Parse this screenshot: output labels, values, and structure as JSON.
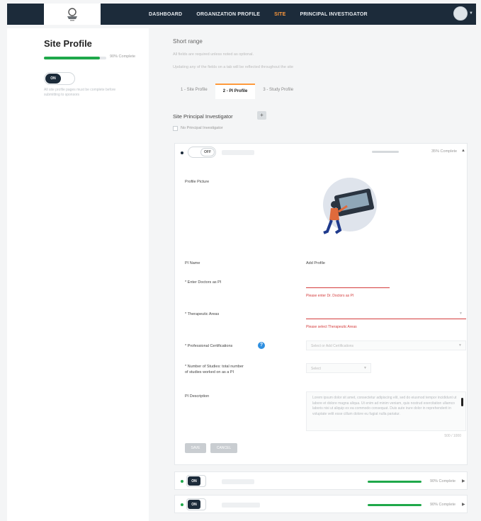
{
  "nav": {
    "items": [
      {
        "label": "DASHBOARD",
        "active": false
      },
      {
        "label": "ORGANIZATION PROFILE",
        "active": false
      },
      {
        "label": "SITE",
        "active": true
      },
      {
        "label": "PRINCIPAL INVESTIGATOR",
        "active": false
      }
    ]
  },
  "sidebar": {
    "title": "Site Profile",
    "progress_percent": 90,
    "progress_label": "90% Complete",
    "toggle_label": "ON",
    "note_line1": "All site profile pages must be complete before",
    "note_line2": "submitting to sponsors"
  },
  "main": {
    "title": "Short range",
    "subtitle1": "All fields are required unless noted as optional.",
    "subtitle2": "Updating any of the fields on a tab will be reflected throughout the site",
    "tabs": [
      {
        "label": "1 - Site Profile",
        "active": false
      },
      {
        "label": "2 - PI Profile",
        "active": true
      },
      {
        "label": "3 - Study Profile",
        "active": false
      }
    ],
    "section_label": "Site Principal Investigator",
    "add_symbol": "+",
    "checkbox_label": "No Principal Investigator"
  },
  "pi_card": {
    "toggle_label": "OFF",
    "pct_label": "35% Complete",
    "progress_percent": 35,
    "profile_picture_label": "Profile Picture",
    "pi_name_label": "PI Name",
    "pi_name_value": "Add Profile",
    "field1_label": "* Enter Doctors as PI",
    "field1_error": "Please enter Dr. Doctors as PI",
    "field2_label": "* Therapeutic Areas",
    "field2_error": "Please select Therapeutic Areas",
    "field3_label": "* Professional Certifications",
    "field3_placeholder": "Select or Add Certifications",
    "help_symbol": "?",
    "field4_label_line1": "* Number of Studies: total number",
    "field4_label_line2": "of studies worked on as a PI",
    "field4_placeholder": "Select",
    "desc_label": "PI Description",
    "desc_text": "Lorem ipsum dolor sit amet, consectetur adipiscing elit, sed do eiusmod tempor incididunt ut labore et dolore magna aliqua. Ut enim ad minim veniam, quis nostrud exercitation ullamco laboris nisi ut aliquip ex ea commodo consequat. Duis aute irure dolor in reprehenderit in voluptate velit esse cillum dolore eu fugiat nulla pariatur.",
    "char_count": "500 / 1000",
    "save_label": "SAVE",
    "cancel_label": "CANCEL"
  },
  "cards": [
    {
      "toggle_label": "ON",
      "pct_label": "90% Complete",
      "progress_percent": 90
    },
    {
      "toggle_label": "ON",
      "pct_label": "90% Complete",
      "progress_percent": 90
    }
  ],
  "arrows": {
    "up": "▲",
    "right": "▶"
  },
  "colors": {
    "navy": "#1c2b3a",
    "accent": "#ff9a3c",
    "green": "#1fa84a",
    "error": "#d43c3c",
    "info": "#2e8fe0"
  }
}
